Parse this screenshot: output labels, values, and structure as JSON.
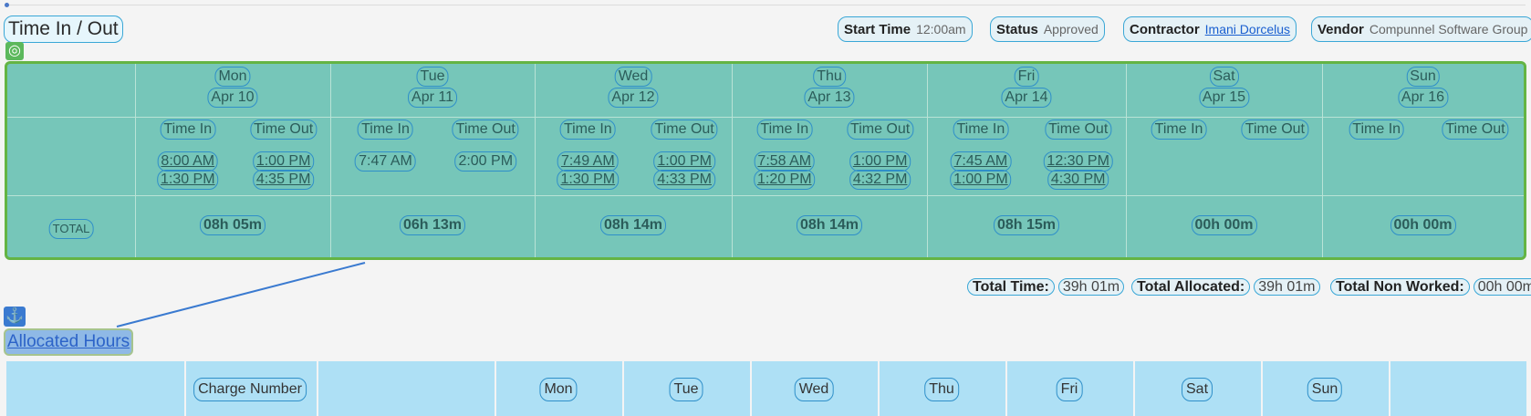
{
  "header": {
    "title": "Time In / Out",
    "start_time_label": "Start Time",
    "start_time_value": "12:00am",
    "status_label": "Status",
    "status_value": "Approved",
    "contractor_label": "Contractor",
    "contractor_value": "Imani Dorcelus",
    "vendor_label": "Vendor",
    "vendor_value": "Compunnel Software Group"
  },
  "grid": {
    "time_in_label": "Time In",
    "time_out_label": "Time Out",
    "total_label": "TOTAL",
    "days": [
      {
        "day": "Mon",
        "date": "Apr 10",
        "in1": "8:00 AM",
        "out1": "1:00 PM",
        "in2": "1:30 PM",
        "out2": "4:35 PM",
        "total": "08h 05m"
      },
      {
        "day": "Tue",
        "date": "Apr 11",
        "in1": "7:47 AM",
        "out1": "2:00 PM",
        "in2": "",
        "out2": "",
        "total": "06h 13m"
      },
      {
        "day": "Wed",
        "date": "Apr 12",
        "in1": "7:49 AM",
        "out1": "1:00 PM",
        "in2": "1:30 PM",
        "out2": "4:33 PM",
        "total": "08h 14m"
      },
      {
        "day": "Thu",
        "date": "Apr 13",
        "in1": "7:58 AM",
        "out1": "1:00 PM",
        "in2": "1:20 PM",
        "out2": "4:32 PM",
        "total": "08h 14m"
      },
      {
        "day": "Fri",
        "date": "Apr 14",
        "in1": "7:45 AM",
        "out1": "12:30 PM",
        "in2": "1:00 PM",
        "out2": "4:30 PM",
        "total": "08h 15m"
      },
      {
        "day": "Sat",
        "date": "Apr 15",
        "in1": "",
        "out1": "",
        "in2": "",
        "out2": "",
        "total": "00h 00m"
      },
      {
        "day": "Sun",
        "date": "Apr 16",
        "in1": "",
        "out1": "",
        "in2": "",
        "out2": "",
        "total": "00h 00m"
      }
    ]
  },
  "totals": {
    "total_time_label": "Total Time:",
    "total_time_value": "39h 01m",
    "total_allocated_label": "Total Allocated:",
    "total_allocated_value": "39h 01m",
    "total_non_worked_label": "Total Non Worked:",
    "total_non_worked_value": "00h 00m"
  },
  "allocated": {
    "title": "Allocated Hours",
    "charge_number_label": "Charge Number",
    "days": [
      "Mon",
      "Tue",
      "Wed",
      "Thu",
      "Fri",
      "Sat",
      "Sun"
    ]
  },
  "icons": {
    "target": "target-icon",
    "anchor": "anchor-icon"
  }
}
